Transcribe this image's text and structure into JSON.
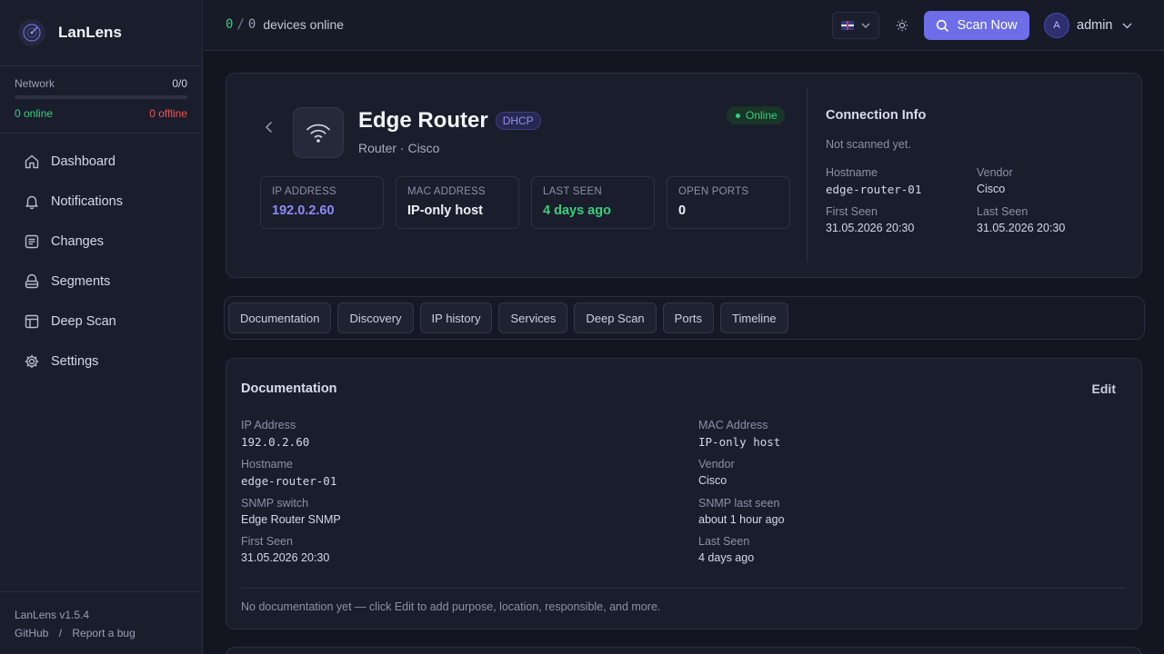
{
  "app": {
    "name": "LanLens",
    "version": "LanLens v1.5.4"
  },
  "sidebar": {
    "network": {
      "label": "Network",
      "count": "0/0",
      "online": "0 online",
      "offline": "0 offline",
      "online_fraction": 0
    },
    "items": [
      {
        "label": "Dashboard",
        "icon": "home-icon"
      },
      {
        "label": "Notifications",
        "icon": "bell-icon"
      },
      {
        "label": "Changes",
        "icon": "list-icon"
      },
      {
        "label": "Segments",
        "icon": "layers-icon"
      },
      {
        "label": "Deep Scan",
        "icon": "table-icon"
      },
      {
        "label": "Settings",
        "icon": "gear-icon"
      }
    ],
    "footer": {
      "github": "GitHub",
      "sep": "/",
      "report": "Report a bug"
    }
  },
  "topbar": {
    "online_count": "0",
    "total_count": "0",
    "slash": "/",
    "devices_label": "devices online",
    "scan_label": "Scan Now",
    "user_initial": "A",
    "user_name": "admin"
  },
  "device": {
    "name": "Edge Router",
    "badge": "DHCP",
    "subtitle": "Router · Cisco",
    "status": "Online",
    "stats": [
      {
        "label": "IP ADDRESS",
        "value": "192.0.2.60"
      },
      {
        "label": "MAC ADDRESS",
        "value": "IP-only host"
      },
      {
        "label": "LAST SEEN",
        "value": "4 days ago"
      },
      {
        "label": "OPEN PORTS",
        "value": "0"
      }
    ],
    "connection": {
      "title": "Connection Info",
      "note": "Not scanned yet.",
      "hostname_label": "Hostname",
      "hostname": "edge-router-01",
      "vendor_label": "Vendor",
      "vendor": "Cisco",
      "first_seen_label": "First Seen",
      "first_seen": "31.05.2026 20:30",
      "last_seen_label": "Last Seen",
      "last_seen": "31.05.2026 20:30"
    }
  },
  "tabs": [
    "Documentation",
    "Discovery",
    "IP history",
    "Services",
    "Deep Scan",
    "Ports",
    "Timeline"
  ],
  "documentation": {
    "title": "Documentation",
    "edit_label": "Edit",
    "fields": [
      {
        "label": "IP Address",
        "value": "192.0.2.60"
      },
      {
        "label": "MAC Address",
        "value": "IP-only host"
      },
      {
        "label": "Hostname",
        "value": "edge-router-01"
      },
      {
        "label": "Vendor",
        "value": "Cisco"
      },
      {
        "label": "SNMP switch",
        "value": "Edge Router SNMP"
      },
      {
        "label": "SNMP last seen",
        "value": "about 1 hour ago"
      },
      {
        "label": "First Seen",
        "value": "31.05.2026 20:30"
      },
      {
        "label": "Last Seen",
        "value": "4 days ago"
      }
    ],
    "note": "No documentation yet — click Edit to add purpose, location, responsible, and more."
  },
  "colors": {
    "accent": "#6d6de8",
    "online": "#34d07a",
    "offline": "#f05454",
    "background": "#131520",
    "panel": "#1a1d2c"
  }
}
